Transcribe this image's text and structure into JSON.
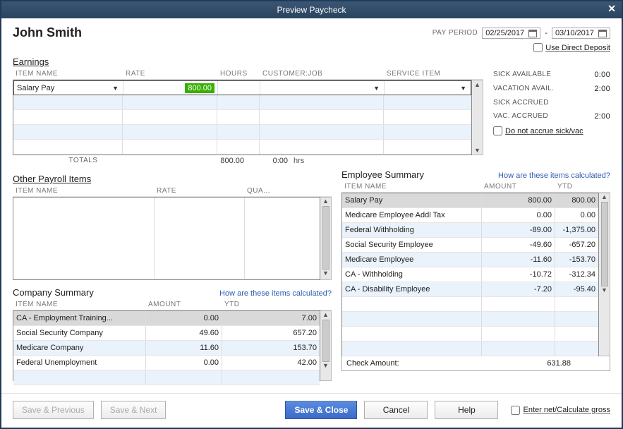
{
  "window": {
    "title": "Preview Paycheck"
  },
  "employee_name": "John Smith",
  "pay_period": {
    "label": "PAY PERIOD",
    "start": "02/25/2017",
    "end": "03/10/2017",
    "dash": "-"
  },
  "use_direct_deposit": {
    "label": "Use Direct Deposit",
    "checked": false
  },
  "earnings": {
    "title": "Earnings",
    "columns": {
      "item": "ITEM NAME",
      "rate": "RATE",
      "hours": "HOURS",
      "customer": "CUSTOMER:JOB",
      "service": "SERVICE ITEM"
    },
    "rows": [
      {
        "item": "Salary Pay",
        "rate": "800.00",
        "hours": "",
        "customer": "",
        "service": ""
      }
    ],
    "totals_label": "TOTALS",
    "total_rate": "800.00",
    "total_hours": "0:00",
    "hours_unit": "hrs"
  },
  "side_stats": {
    "sick_available": {
      "label": "SICK AVAILABLE",
      "value": "0:00"
    },
    "vacation_available": {
      "label": "VACATION AVAIL.",
      "value": "2:00"
    },
    "sick_accrued": {
      "label": "SICK ACCRUED",
      "value": ""
    },
    "vac_accrued": {
      "label": "VAC. ACCRUED",
      "value": "2:00"
    },
    "do_not_accrue": {
      "label": "Do not accrue sick/vac",
      "checked": false
    }
  },
  "other_payroll": {
    "title": "Other Payroll Items",
    "columns": {
      "item": "ITEM NAME",
      "rate": "RATE",
      "qty": "QUA..."
    }
  },
  "company_summary": {
    "title": "Company Summary",
    "link": "How are these items calculated?",
    "columns": {
      "item": "ITEM NAME",
      "amount": "AMOUNT",
      "ytd": "YTD"
    },
    "rows": [
      {
        "item": "CA - Employment Training...",
        "amount": "0.00",
        "ytd": "7.00"
      },
      {
        "item": "Social Security Company",
        "amount": "49.60",
        "ytd": "657.20"
      },
      {
        "item": "Medicare Company",
        "amount": "11.60",
        "ytd": "153.70"
      },
      {
        "item": "Federal Unemployment",
        "amount": "0.00",
        "ytd": "42.00"
      }
    ]
  },
  "employee_summary": {
    "title": "Employee Summary",
    "link": "How are these items calculated?",
    "columns": {
      "item": "ITEM NAME",
      "amount": "AMOUNT",
      "ytd": "YTD"
    },
    "rows": [
      {
        "item": "Salary Pay",
        "amount": "800.00",
        "ytd": "800.00"
      },
      {
        "item": "Medicare Employee Addl Tax",
        "amount": "0.00",
        "ytd": "0.00"
      },
      {
        "item": "Federal Withholding",
        "amount": "-89.00",
        "ytd": "-1,375.00"
      },
      {
        "item": "Social Security Employee",
        "amount": "-49.60",
        "ytd": "-657.20"
      },
      {
        "item": "Medicare Employee",
        "amount": "-11.60",
        "ytd": "-153.70"
      },
      {
        "item": "CA - Withholding",
        "amount": "-10.72",
        "ytd": "-312.34"
      },
      {
        "item": "CA - Disability Employee",
        "amount": "-7.20",
        "ytd": "-95.40"
      }
    ],
    "check_amount": {
      "label": "Check Amount:",
      "value": "631.88"
    }
  },
  "footer": {
    "save_previous": "Save & Previous",
    "save_next": "Save & Next",
    "save_close": "Save & Close",
    "cancel": "Cancel",
    "help": "Help",
    "enter_net": "Enter net/Calculate gross"
  }
}
